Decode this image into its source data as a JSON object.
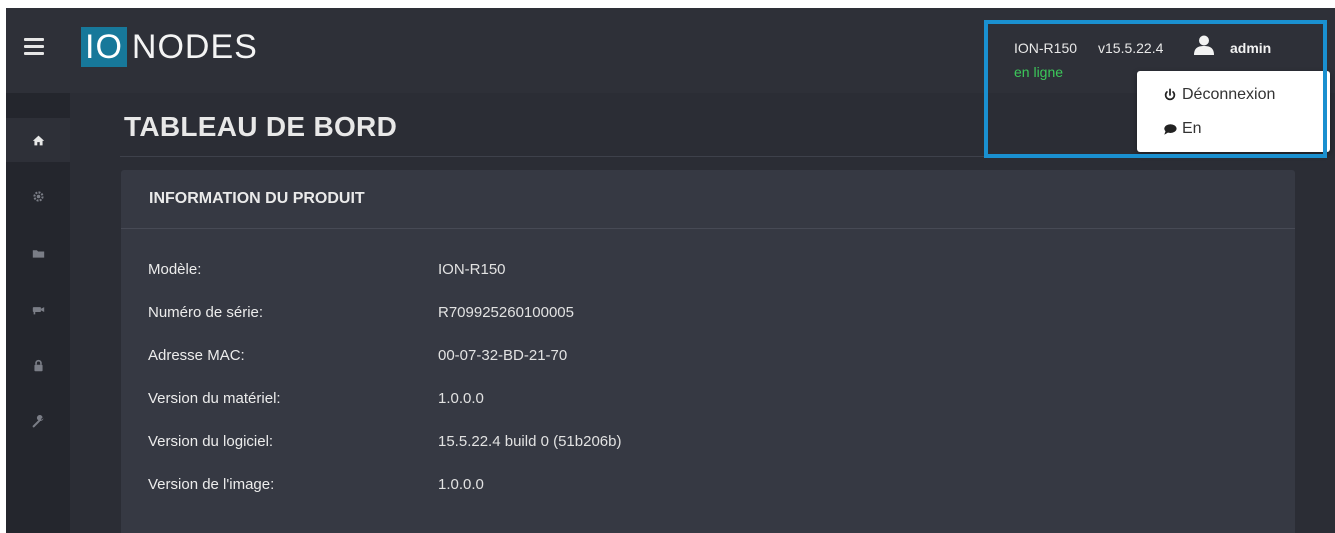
{
  "app": {
    "logo": {
      "io": "IO",
      "nodes": "NODES"
    },
    "page_title": "TABLEAU DE BORD"
  },
  "header": {
    "device_model": "ION-R150",
    "firmware_version": "v15.5.22.4",
    "status": "en ligne",
    "user": "admin"
  },
  "user_menu": {
    "items": [
      {
        "label": "Déconnexion",
        "icon": "power-icon"
      },
      {
        "label": "En",
        "icon": "chat-bubble-icon"
      }
    ]
  },
  "sidebar": {
    "items": [
      {
        "icon": "home-icon",
        "active": true
      },
      {
        "icon": "gear-icon",
        "active": false
      },
      {
        "icon": "folder-icon",
        "active": false
      },
      {
        "icon": "camera-icon",
        "active": false
      },
      {
        "icon": "lock-icon",
        "active": false
      },
      {
        "icon": "wrench-icon",
        "active": false
      }
    ]
  },
  "product_info": {
    "title": "INFORMATION DU PRODUIT",
    "rows": [
      {
        "label": "Modèle:",
        "value": "ION-R150"
      },
      {
        "label": "Numéro de série:",
        "value": "R709925260100005"
      },
      {
        "label": "Adresse MAC:",
        "value": "00-07-32-BD-21-70"
      },
      {
        "label": "Version du matériel:",
        "value": "1.0.0.0"
      },
      {
        "label": "Version du logiciel:",
        "value": "15.5.22.4 build 0 (51b206b)"
      },
      {
        "label": "Version de l'image:",
        "value": "1.0.0.0"
      }
    ]
  },
  "colors": {
    "accent": "#17789a",
    "highlight_border": "#1a90d0",
    "status_online": "#3cc85a",
    "background": "#2b2d35",
    "panel": "#363943"
  }
}
